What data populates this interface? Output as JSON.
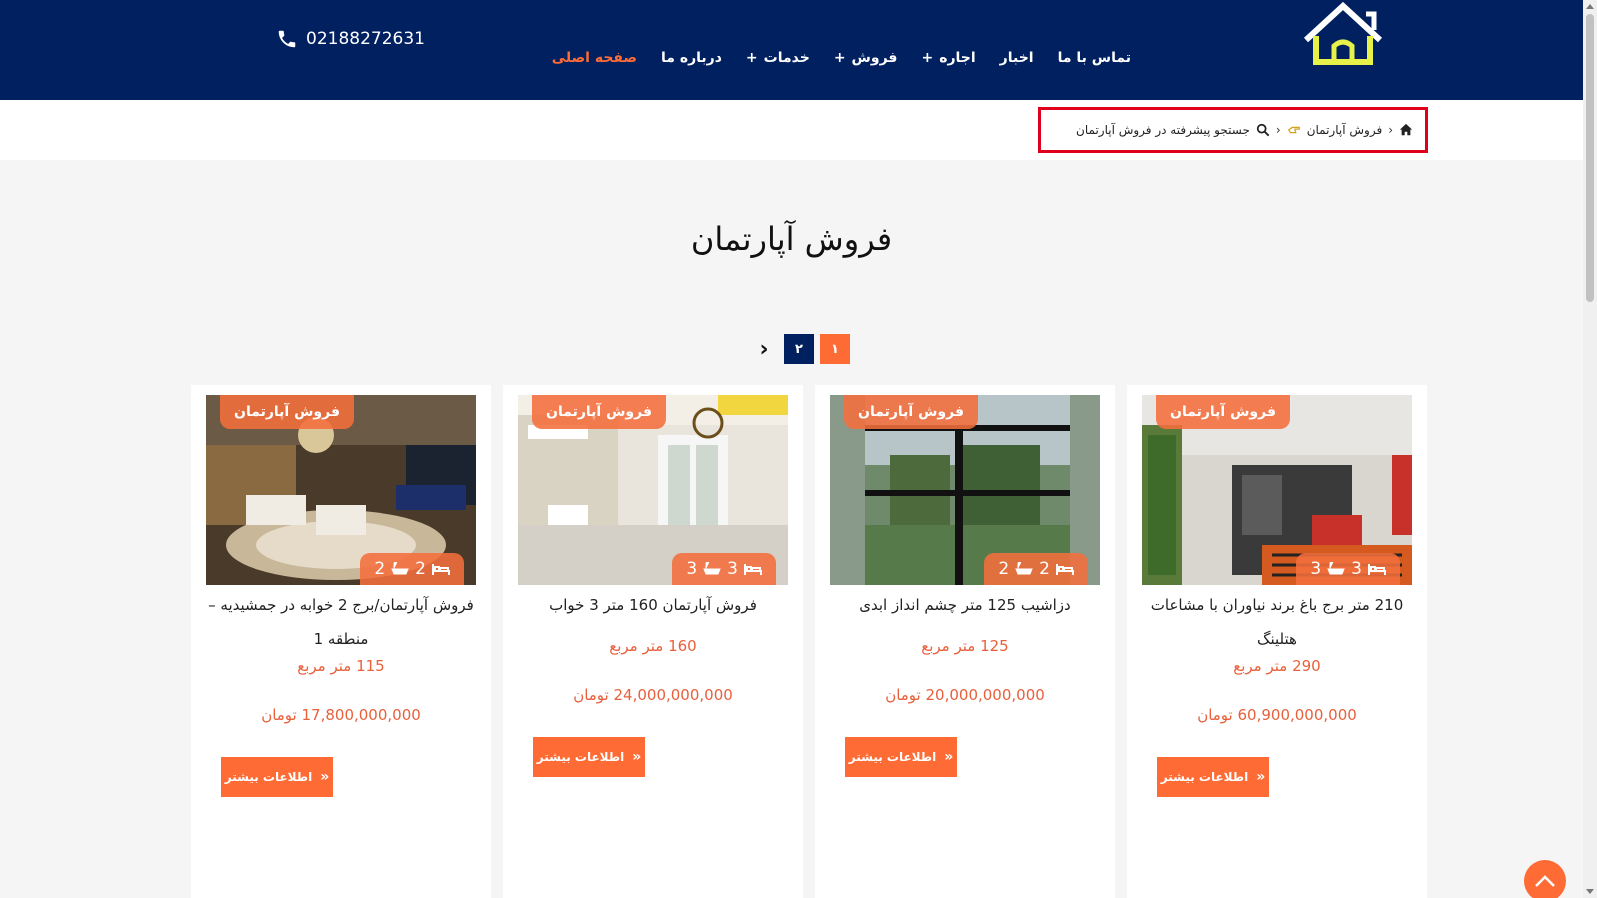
{
  "header": {
    "phone": "02188272631",
    "nav": [
      {
        "label": "صفحه اصلی",
        "active": true,
        "plus": false
      },
      {
        "label": "درباره ما",
        "active": false,
        "plus": false
      },
      {
        "label": "خدمات",
        "active": false,
        "plus": true
      },
      {
        "label": "فروش",
        "active": false,
        "plus": true
      },
      {
        "label": "اجاره",
        "active": false,
        "plus": true
      },
      {
        "label": "اخبار",
        "active": false,
        "plus": false
      },
      {
        "label": "تماس با ما",
        "active": false,
        "plus": false
      }
    ],
    "plus_symbol": "+"
  },
  "breadcrumb": {
    "item1": "فروش آپارتمان",
    "item2": "جستجو پیشرفته در فروش آپارتمان",
    "separator": "›"
  },
  "page": {
    "title": "فروش آپارتمان"
  },
  "pagination": {
    "next_symbol": "›",
    "pages": [
      "۲",
      "۱"
    ],
    "current": "۱"
  },
  "listings": [
    {
      "tag": "فروش آپارتمان",
      "title": "210 متر برج باغ برند نیاوران با مشاعات هتلینگ",
      "beds": "3",
      "baths": "3",
      "area": "290 متر مربع",
      "price": "60,900,000,000 تومان",
      "button": "اطلاعات بیشتر"
    },
    {
      "tag": "فروش آپارتمان",
      "title": "دزاشیب 125 متر چشم انداز ابدی",
      "beds": "2",
      "baths": "2",
      "area": "125 متر مربع",
      "price": "20,000,000,000 تومان",
      "button": "اطلاعات بیشتر"
    },
    {
      "tag": "فروش آپارتمان",
      "title": "فروش آپارتمان 160 متر 3 خواب",
      "beds": "3",
      "baths": "3",
      "area": "160 متر مربع",
      "price": "24,000,000,000 تومان",
      "button": "اطلاعات بیشتر"
    },
    {
      "tag": "فروش آپارتمان",
      "title": "فروش آپارتمان/برج 2 خوابه در جمشیدیه – منطقه 1",
      "beds": "2",
      "baths": "2",
      "area": "115 متر مربع",
      "price": "17,800,000,000 تومان",
      "button": "اطلاعات بیشتر"
    }
  ],
  "icons": {
    "logo": "house-logo-icon",
    "phone": "phone-icon",
    "home": "home-icon",
    "hand": "hand-pointer-icon",
    "search": "search-icon",
    "bed": "bed-icon",
    "bath": "bath-icon",
    "chevrons": "double-chevron-icon",
    "to_top": "chevron-up-icon"
  },
  "colors": {
    "header_bg": "#002060",
    "accent": "#ff6b35",
    "breadcrumb_border": "#e0001b",
    "logo": "#e6f24a"
  }
}
